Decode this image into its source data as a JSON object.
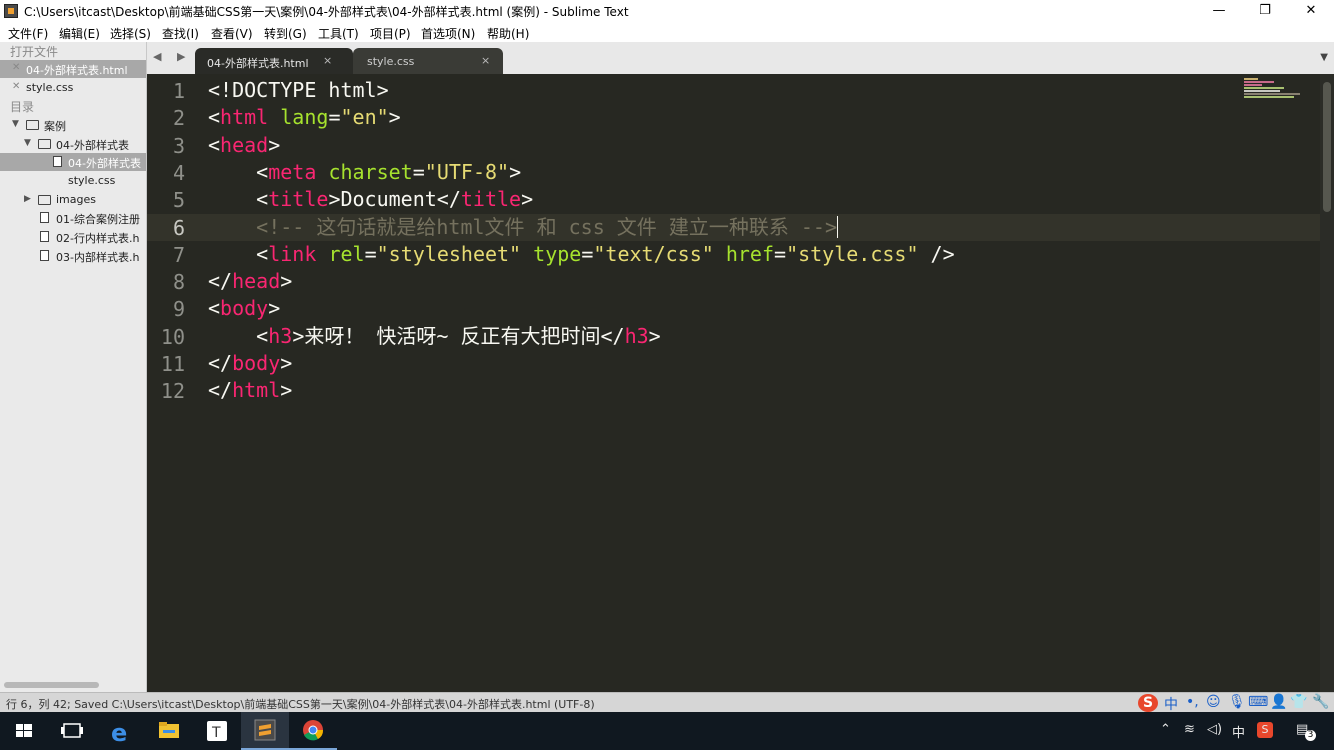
{
  "window": {
    "title": "C:\\Users\\itcast\\Desktop\\前端基础CSS第一天\\案例\\04-外部样式表\\04-外部样式表.html (案例) - Sublime Text",
    "minimize": "—",
    "maximize": "❐",
    "close": "✕"
  },
  "menu": [
    "文件(F)",
    "编辑(E)",
    "选择(S)",
    "查找(I)",
    "查看(V)",
    "转到(G)",
    "工具(T)",
    "项目(P)",
    "首选项(N)",
    "帮助(H)"
  ],
  "sidebar": {
    "open_files_header": "打开文件",
    "open_files": [
      "04-外部样式表.html",
      "style.css"
    ],
    "folders_header": "目录",
    "tree": {
      "root": "案例",
      "sub_folder": "04-外部样式表",
      "sub_files": [
        "04-外部样式表",
        "style.css"
      ],
      "images": "images",
      "files": [
        "01-综合案例注册",
        "02-行内样式表.h",
        "03-内部样式表.h"
      ]
    }
  },
  "tabs": [
    {
      "label": "04-外部样式表.html",
      "close": "×",
      "active": true
    },
    {
      "label": "style.css",
      "close": "×",
      "active": false
    }
  ],
  "tab_nav": "◀ ▶",
  "tab_dropdown": "▼",
  "editor": {
    "current_line": 6,
    "line_numbers": [
      "1",
      "2",
      "3",
      "4",
      "5",
      "6",
      "7",
      "8",
      "9",
      "10",
      "11",
      "12"
    ],
    "lines": [
      [
        {
          "t": "t",
          "v": "<!DOCTYPE html>"
        }
      ],
      [
        {
          "t": "t",
          "v": "<"
        },
        {
          "t": "k",
          "v": "html"
        },
        {
          "t": "t",
          "v": " "
        },
        {
          "t": "a",
          "v": "lang"
        },
        {
          "t": "t",
          "v": "="
        },
        {
          "t": "s",
          "v": "\"en\""
        },
        {
          "t": "t",
          "v": ">"
        }
      ],
      [
        {
          "t": "t",
          "v": "<"
        },
        {
          "t": "k",
          "v": "head"
        },
        {
          "t": "t",
          "v": ">"
        }
      ],
      [
        {
          "t": "t",
          "v": "    <"
        },
        {
          "t": "k",
          "v": "meta"
        },
        {
          "t": "t",
          "v": " "
        },
        {
          "t": "a",
          "v": "charset"
        },
        {
          "t": "t",
          "v": "="
        },
        {
          "t": "s",
          "v": "\"UTF-8\""
        },
        {
          "t": "t",
          "v": ">"
        }
      ],
      [
        {
          "t": "t",
          "v": "    <"
        },
        {
          "t": "k",
          "v": "title"
        },
        {
          "t": "t",
          "v": ">Document</"
        },
        {
          "t": "k",
          "v": "title"
        },
        {
          "t": "t",
          "v": ">"
        }
      ],
      [
        {
          "t": "c",
          "v": "    <!-- 这句话就是给html文件 和 css 文件 建立一种联系 -->"
        }
      ],
      [
        {
          "t": "t",
          "v": "    <"
        },
        {
          "t": "k",
          "v": "link"
        },
        {
          "t": "t",
          "v": " "
        },
        {
          "t": "a",
          "v": "rel"
        },
        {
          "t": "t",
          "v": "="
        },
        {
          "t": "s",
          "v": "\"stylesheet\""
        },
        {
          "t": "t",
          "v": " "
        },
        {
          "t": "a",
          "v": "type"
        },
        {
          "t": "t",
          "v": "="
        },
        {
          "t": "s",
          "v": "\"text/css\""
        },
        {
          "t": "t",
          "v": " "
        },
        {
          "t": "a",
          "v": "href"
        },
        {
          "t": "t",
          "v": "="
        },
        {
          "t": "s",
          "v": "\"style.css\""
        },
        {
          "t": "t",
          "v": " />"
        }
      ],
      [
        {
          "t": "t",
          "v": "</"
        },
        {
          "t": "k",
          "v": "head"
        },
        {
          "t": "t",
          "v": ">"
        }
      ],
      [
        {
          "t": "t",
          "v": "<"
        },
        {
          "t": "k",
          "v": "body"
        },
        {
          "t": "t",
          "v": ">"
        }
      ],
      [
        {
          "t": "t",
          "v": "    <"
        },
        {
          "t": "k",
          "v": "h3"
        },
        {
          "t": "t",
          "v": ">来呀！ 快活呀~ 反正有大把时间</"
        },
        {
          "t": "k",
          "v": "h3"
        },
        {
          "t": "t",
          "v": ">"
        }
      ],
      [
        {
          "t": "t",
          "v": "</"
        },
        {
          "t": "k",
          "v": "body"
        },
        {
          "t": "t",
          "v": ">"
        }
      ],
      [
        {
          "t": "t",
          "v": "</"
        },
        {
          "t": "k",
          "v": "html"
        },
        {
          "t": "t",
          "v": ">"
        }
      ]
    ]
  },
  "statusbar": {
    "text": "行 6，列 42; Saved C:\\Users\\itcast\\Desktop\\前端基础CSS第一天\\案例\\04-外部样式表\\04-外部样式表.html (UTF-8)"
  },
  "ime_toolbar": {
    "logo": "S",
    "mode": "中",
    "punct": "•,",
    "emoji_icon": "☺",
    "mic_icon": "🎙",
    "keyboard_icon": "⌨",
    "user_icon": "👤",
    "shirt_icon": "👕",
    "tools_icon": "🔧"
  },
  "taskbar": {
    "tray_lang": "中",
    "notification_count": "3"
  },
  "colors": {
    "editor_bg": "#272822",
    "keyword": "#f92672",
    "attribute": "#a6e22e",
    "string": "#e6db74",
    "comment": "#75715e",
    "text": "#f8f8f2"
  }
}
